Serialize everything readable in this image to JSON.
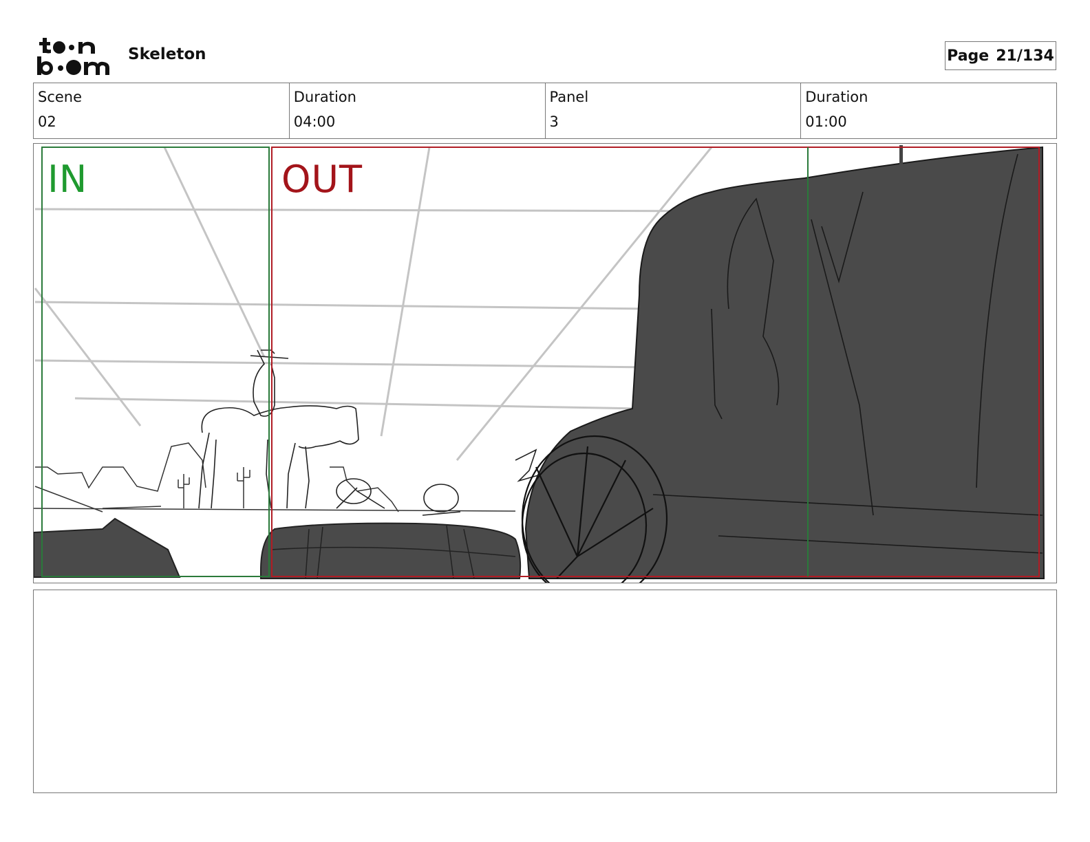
{
  "header": {
    "logo_text": "toon boom",
    "project_title": "Skeleton",
    "page_label": "Page",
    "page_value": "21/134"
  },
  "info": {
    "scene_label": "Scene",
    "scene_value": "02",
    "scene_duration_label": "Duration",
    "scene_duration_value": "04:00",
    "panel_label": "Panel",
    "panel_value": "3",
    "panel_duration_label": "Duration",
    "panel_duration_value": "01:00"
  },
  "panel": {
    "in_label": "IN",
    "out_label": "OUT",
    "in_color": "#1f9a2f",
    "out_color": "#a3141a"
  },
  "notes": {
    "text": ""
  }
}
